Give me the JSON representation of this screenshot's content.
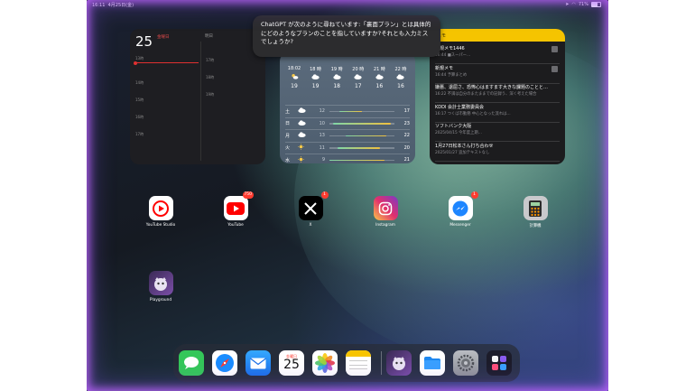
{
  "status_bar": {
    "time": "16:11",
    "date": "4月25日(金)",
    "battery": "71%"
  },
  "tooltip": {
    "text": "ChatGPT が次のように尋ねています:「裏面プラン」とは具体的にどのようなプランのことを指していますか?それとも入力ミスでしょうか?"
  },
  "calendar_widget": {
    "day_number": "25",
    "weekday": "金曜日",
    "header": "明日",
    "hours": [
      "13時",
      "14時",
      "15時",
      "16時",
      "17時",
      "18時",
      "19時"
    ]
  },
  "weather_widget": {
    "hourly": [
      {
        "time": "18:02",
        "icon": "sun-cloud-icon",
        "temp": "19"
      },
      {
        "time": "18 時",
        "icon": "cloud-icon",
        "temp": "19"
      },
      {
        "time": "19 時",
        "icon": "cloud-icon",
        "temp": "18"
      },
      {
        "time": "20 時",
        "icon": "cloud-icon",
        "temp": "17"
      },
      {
        "time": "21 時",
        "icon": "cloud-icon",
        "temp": "16"
      },
      {
        "time": "22 時",
        "icon": "cloud-icon",
        "temp": "16"
      }
    ],
    "daily": [
      {
        "day": "土",
        "icon": "cloud-icon",
        "low": "12",
        "high": "17",
        "range": [
          0.15,
          0.5
        ]
      },
      {
        "day": "日",
        "icon": "cloud-icon",
        "low": "10",
        "high": "23",
        "range": [
          0.05,
          0.95
        ]
      },
      {
        "day": "月",
        "icon": "cloud-icon",
        "low": "13",
        "high": "22",
        "range": [
          0.25,
          0.88
        ]
      },
      {
        "day": "火",
        "icon": "sun-icon",
        "low": "11",
        "high": "20",
        "range": [
          0.12,
          0.78
        ]
      },
      {
        "day": "水",
        "icon": "sun-icon",
        "low": "9",
        "high": "21",
        "range": [
          0.0,
          0.85
        ]
      }
    ]
  },
  "notes_widget": {
    "title": "メモ",
    "items": [
      {
        "title": "新規メモ1446",
        "sub": "16:44 ■スーパー…"
      },
      {
        "title": "新規メモ",
        "sub": "16:44 予算まとめ"
      },
      {
        "title": "嫌悪、退屈さ、恐怖心はますます大きな課題のことと…",
        "sub": "16:22 不満は自分のまたままでの記録う、深く考えた場合"
      },
      {
        "title": "KDDI 会計士業務委員会",
        "sub": "16:17 つくば市勤務 中心となった流れは…"
      },
      {
        "title": "ソフトバンク大阪",
        "sub": "2025/04/15 今年度上期…"
      },
      {
        "title": "1月27日松本さん打ち合わせ",
        "sub": "2025/01/27 追加テキストなし"
      }
    ]
  },
  "apps": [
    {
      "name": "YouTube Studio",
      "badge": ""
    },
    {
      "name": "YouTube",
      "badge": "750"
    },
    {
      "name": "X",
      "badge": "1"
    },
    {
      "name": "Instagram",
      "badge": ""
    },
    {
      "name": "Messenger",
      "badge": "1"
    },
    {
      "name": "計算機",
      "badge": ""
    },
    {
      "name": "Playground",
      "badge": ""
    }
  ],
  "dock": {
    "calendar_day": "25",
    "items": [
      "messages-icon",
      "safari-icon",
      "mail-icon",
      "calendar-icon",
      "photos-icon",
      "notes-icon",
      "playground-icon",
      "files-icon",
      "settings-icon",
      "app-library-icon"
    ]
  }
}
